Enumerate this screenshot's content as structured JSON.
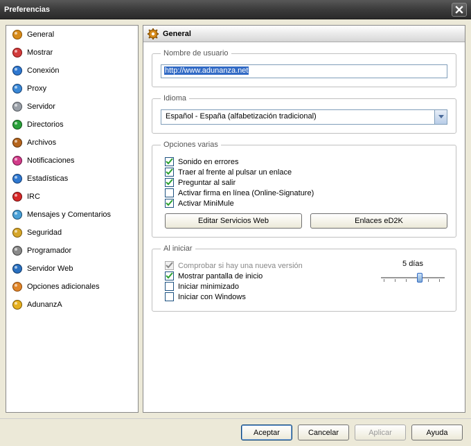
{
  "window": {
    "title": "Preferencias"
  },
  "sidebar": {
    "items": [
      {
        "label": "General",
        "icon": "gear-icon",
        "c1": "#d68a1a",
        "c2": "#8a5200",
        "selected": true
      },
      {
        "label": "Mostrar",
        "icon": "display-icon",
        "c1": "#d23c3c",
        "c2": "#7a1010"
      },
      {
        "label": "Conexión",
        "icon": "connection-icon",
        "c1": "#2f78d0",
        "c2": "#103a70"
      },
      {
        "label": "Proxy",
        "icon": "proxy-icon",
        "c1": "#3a88d6",
        "c2": "#123e72"
      },
      {
        "label": "Servidor",
        "icon": "server-icon",
        "c1": "#9aa0a8",
        "c2": "#4a4f55"
      },
      {
        "label": "Directorios",
        "icon": "folder-icon",
        "c1": "#2aa03a",
        "c2": "#0e5016"
      },
      {
        "label": "Archivos",
        "icon": "files-icon",
        "c1": "#b5651d",
        "c2": "#5a2f08"
      },
      {
        "label": "Notificaciones",
        "icon": "bell-icon",
        "c1": "#d23c8a",
        "c2": "#6a1040"
      },
      {
        "label": "Estadísticas",
        "icon": "stats-icon",
        "c1": "#2f78d0",
        "c2": "#103a70"
      },
      {
        "label": "IRC",
        "icon": "irc-icon",
        "c1": "#d62828",
        "c2": "#6a0e0e"
      },
      {
        "label": "Mensajes y Comentarios",
        "icon": "chat-icon",
        "c1": "#4aa0d6",
        "c2": "#13486e"
      },
      {
        "label": "Seguridad",
        "icon": "lock-icon",
        "c1": "#d6a62a",
        "c2": "#7a5808"
      },
      {
        "label": "Programador",
        "icon": "schedule-icon",
        "c1": "#8a8a8a",
        "c2": "#3a3a3a"
      },
      {
        "label": "Servidor Web",
        "icon": "globe-icon",
        "c1": "#2a70c0",
        "c2": "#0d3766"
      },
      {
        "label": "Opciones adicionales",
        "icon": "plus-gear-icon",
        "c1": "#e0862a",
        "c2": "#8a4608"
      },
      {
        "label": "AdunanzA",
        "icon": "adunanza-icon",
        "c1": "#e6b020",
        "c2": "#7a5600"
      }
    ]
  },
  "main": {
    "title": "General",
    "groups": {
      "username": {
        "legend": "Nombre de usuario",
        "value": "http://www.adunanza.net"
      },
      "language": {
        "legend": "Idioma",
        "value": "Español - España (alfabetización tradicional)"
      },
      "misc": {
        "legend": "Opciones varias",
        "checks": [
          {
            "label": "Sonido en errores",
            "checked": true
          },
          {
            "label": "Traer al frente al pulsar un enlace",
            "checked": true
          },
          {
            "label": "Preguntar al salir",
            "checked": true
          },
          {
            "label": "Activar firma en línea (Online-Signature)",
            "checked": false
          },
          {
            "label": "Activar MiniMule",
            "checked": true
          }
        ],
        "buttons": [
          "Editar Servicios Web",
          "Enlaces eD2K"
        ]
      },
      "startup": {
        "legend": "Al iniciar",
        "checks": [
          {
            "label": "Comprobar si hay una nueva versión",
            "checked": true,
            "disabled": true
          },
          {
            "label": "Mostrar pantalla de inicio",
            "checked": true
          },
          {
            "label": "Iniciar minimizado",
            "checked": false
          },
          {
            "label": "Iniciar con Windows",
            "checked": false
          }
        ],
        "days_label": "5 días"
      }
    }
  },
  "footer": {
    "ok": "Aceptar",
    "cancel": "Cancelar",
    "apply": "Aplicar",
    "help": "Ayuda"
  }
}
